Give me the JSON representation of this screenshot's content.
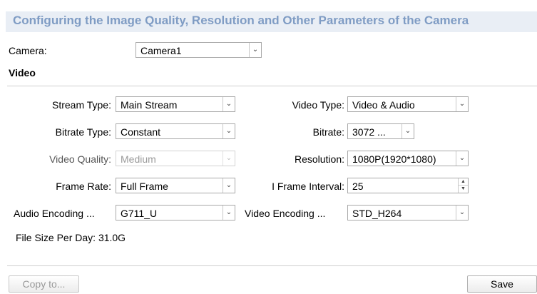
{
  "header": {
    "title": "Configuring the Image Quality, Resolution and Other Parameters of the Camera"
  },
  "camera": {
    "label": "Camera:",
    "value": "Camera1"
  },
  "section": {
    "title": "Video"
  },
  "fields": {
    "stream_type": {
      "label": "Stream Type:",
      "value": "Main Stream"
    },
    "video_type": {
      "label": "Video Type:",
      "value": "Video & Audio"
    },
    "bitrate_type": {
      "label": "Bitrate Type:",
      "value": "Constant"
    },
    "bitrate": {
      "label": "Bitrate:",
      "value": "3072 ..."
    },
    "video_quality": {
      "label": "Video Quality:",
      "value": "Medium"
    },
    "resolution": {
      "label": "Resolution:",
      "value": "1080P(1920*1080)"
    },
    "frame_rate": {
      "label": "Frame Rate:",
      "value": "Full Frame"
    },
    "i_frame_interval": {
      "label": "I Frame Interval:",
      "value": "25"
    },
    "audio_encoding": {
      "label": "Audio Encoding ...",
      "value": "G711_U"
    },
    "video_encoding": {
      "label": "Video Encoding ...",
      "value": "STD_H264"
    }
  },
  "file_size": {
    "label": "File Size Per Day:",
    "value": "31.0G"
  },
  "buttons": {
    "copy_to": "Copy to...",
    "save": "Save"
  },
  "icons": {
    "dropdown": "chevron-down-icon",
    "spinner": "spinner-arrows-icon"
  }
}
